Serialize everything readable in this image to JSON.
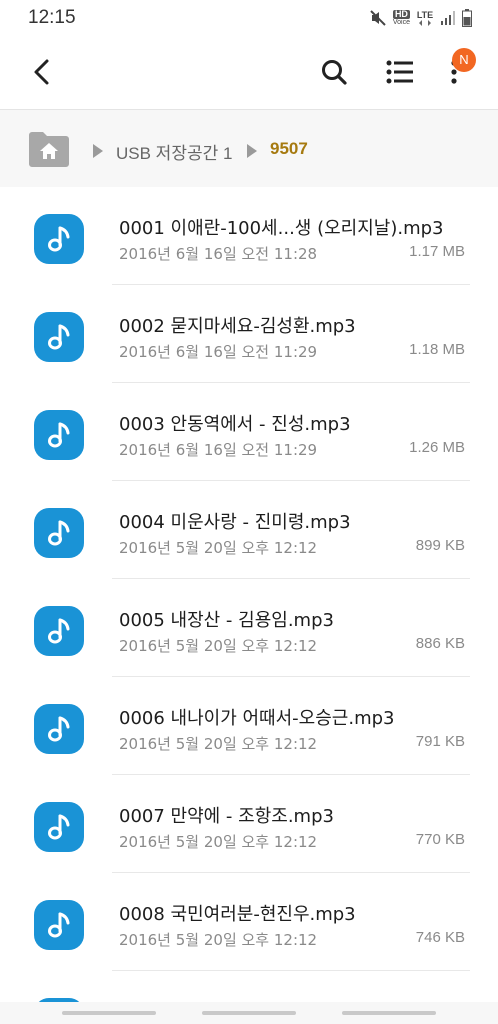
{
  "status_bar": {
    "time": "12:15",
    "icons": [
      "mute-icon",
      "hd-voice-icon",
      "lte-icon",
      "signal-icon",
      "battery-icon"
    ],
    "hd_label": "HD",
    "voice_label": "Voice",
    "lte_label": "LTE"
  },
  "app_bar": {
    "icons": [
      "back-icon",
      "search-icon",
      "list-view-icon",
      "more-icon"
    ],
    "badge": "N"
  },
  "breadcrumb": {
    "root_icon": "home-folder-icon",
    "items": [
      "USB 저장공간 1",
      "9507"
    ]
  },
  "files": [
    {
      "name": "0001 이애란-100세...생 (오리지날).mp3",
      "date": "2016년 6월 16일 오전 11:28",
      "size": "1.17 MB"
    },
    {
      "name": "0002 묻지마세요-김성환.mp3",
      "date": "2016년 6월 16일 오전 11:29",
      "size": "1.18 MB"
    },
    {
      "name": "0003 안동역에서 - 진성.mp3",
      "date": "2016년 6월 16일 오전 11:29",
      "size": "1.26 MB"
    },
    {
      "name": "0004 미운사랑 - 진미령.mp3",
      "date": "2016년 5월 20일 오후 12:12",
      "size": "899 KB"
    },
    {
      "name": "0005 내장산 - 김용임.mp3",
      "date": "2016년 5월 20일 오후 12:12",
      "size": "886 KB"
    },
    {
      "name": "0006 내나이가 어때서-오승근.mp3",
      "date": "2016년 5월 20일 오후 12:12",
      "size": "791 KB"
    },
    {
      "name": "0007 만약에 - 조항조.mp3",
      "date": "2016년 5월 20일 오후 12:12",
      "size": "770 KB"
    },
    {
      "name": "0008 국민여러분-현진우.mp3",
      "date": "2016년 5월 20일 오후 12:12",
      "size": "746 KB"
    }
  ],
  "colors": {
    "accent": "#1a93d6",
    "breadcrumb_current": "#a67a10",
    "badge": "#f26722"
  }
}
